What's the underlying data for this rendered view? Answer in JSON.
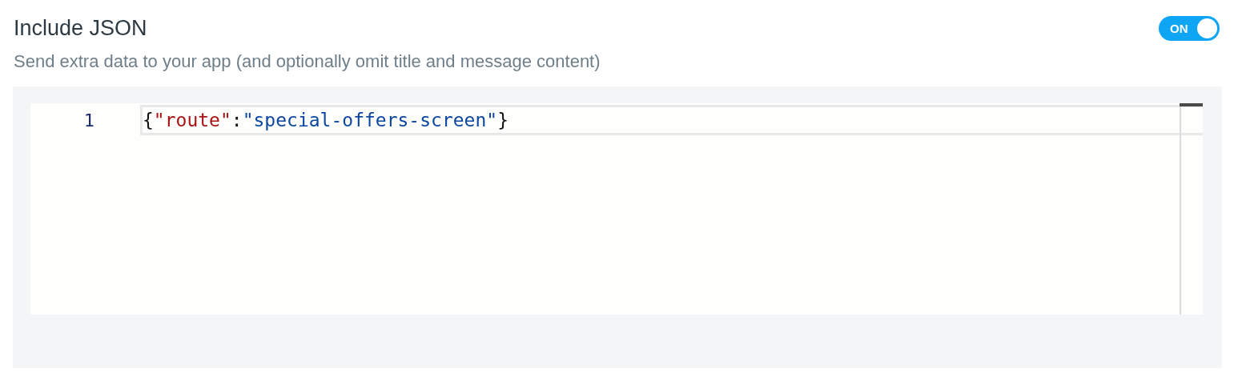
{
  "setting": {
    "title": "Include JSON",
    "description": "Send extra data to your app (and optionally omit title and message content)",
    "toggle": {
      "label": "ON",
      "on": true
    }
  },
  "editor": {
    "lines": [
      {
        "number": "1",
        "active": true,
        "tokens": [
          {
            "kind": "punct",
            "text": "{"
          },
          {
            "kind": "key",
            "text": "\"route\""
          },
          {
            "kind": "punct",
            "text": ":"
          },
          {
            "kind": "string",
            "text": "\"special-offers-screen\""
          },
          {
            "kind": "punct",
            "text": "}"
          }
        ]
      }
    ]
  }
}
